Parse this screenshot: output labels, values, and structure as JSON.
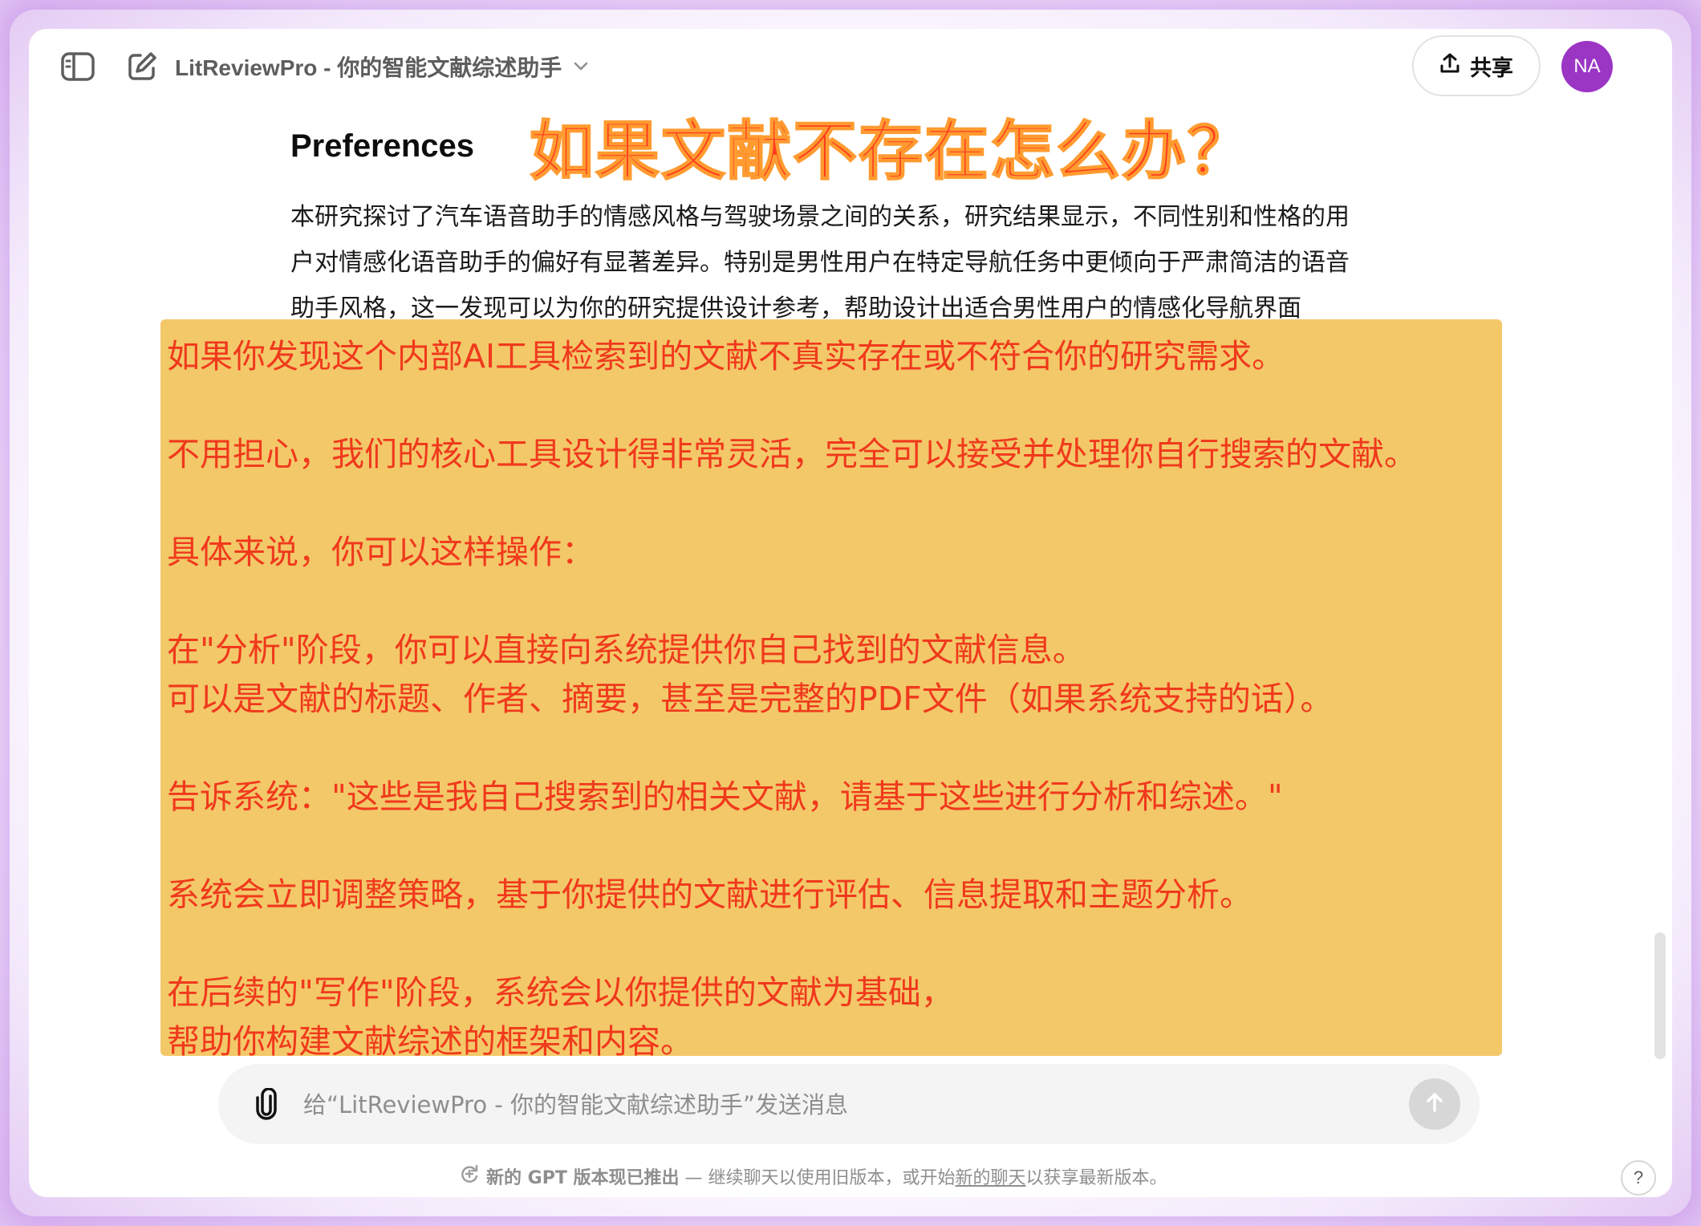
{
  "header": {
    "model_title": "LitReviewPro - 你的智能文献综述助手",
    "share_label": "共享",
    "avatar_initials": "NA"
  },
  "overlay": {
    "question": "如果文献不存在怎么办？"
  },
  "article": {
    "heading": "Preferences",
    "lines": [
      "本研究探讨了汽车语音助手的情感风格与驾驶场景之间的关系，研究结果显示，不同性别和性格的用",
      "户对情感化语音助手的偏好有显著差异。特别是男性用户在特定导航任务中更倾向于严肃简洁的语音",
      "助手风格，这一发现可以为你的研究提供设计参考，帮助设计出适合男性用户的情感化导航界面"
    ]
  },
  "note": {
    "lines": [
      "如果你发现这个内部AI工具检索到的文献不真实存在或不符合你的研究需求。",
      "",
      "不用担心，我们的核心工具设计得非常灵活，完全可以接受并处理你自行搜索的文献。",
      "",
      "具体来说，你可以这样操作：",
      "",
      "在\"分析\"阶段，你可以直接向系统提供你自己找到的文献信息。",
      "可以是文献的标题、作者、摘要，甚至是完整的PDF文件（如果系统支持的话）。",
      "",
      "告诉系统：\"这些是我自己搜索到的相关文献，请基于这些进行分析和综述。\"",
      "",
      "系统会立即调整策略，基于你提供的文献进行评估、信息提取和主题分析。",
      "",
      "在后续的\"写作\"阶段，系统会以你提供的文献为基础，",
      "帮助你构建文献综述的框架和内容。"
    ]
  },
  "composer": {
    "placeholder": "给“LitReviewPro - 你的智能文献综述助手”发送消息"
  },
  "notice": {
    "strong": "新的 GPT 版本现已推出",
    "text_before_link": " — 继续聊天以使用旧版本，或开始",
    "link": "新的聊天",
    "text_after_link": "以获享最新版本。"
  },
  "help": {
    "label": "?"
  },
  "colors": {
    "accent_avatar": "#9b35c4",
    "note_background": "#f3c869",
    "note_text": "#f0391c",
    "overlay_text": "#ff3b1f"
  },
  "icons": {
    "sidebar_toggle": "sidebar-icon",
    "new_chat": "edit-icon",
    "model_dropdown": "chevron-down-icon",
    "share": "upload-icon",
    "attach": "paperclip-icon",
    "send": "arrow-up-icon",
    "notice": "refresh-icon"
  }
}
